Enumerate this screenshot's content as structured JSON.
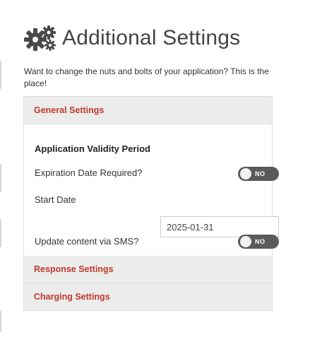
{
  "header": {
    "icon": "gears-icon",
    "title": "Additional Settings",
    "subtitle": "Want to change the nuts and bolts of your application? This is the place!"
  },
  "sections": {
    "general": {
      "label": "General Settings",
      "group_title": "Application Validity Period",
      "expiration_label": "Expiration Date Required?",
      "expiration_toggle": "NO",
      "start_date_label": "Start Date",
      "start_date_value": "2025-01-31",
      "sms_label": "Update content via SMS?",
      "sms_toggle": "NO"
    },
    "response": {
      "label": "Response Settings"
    },
    "charging": {
      "label": "Charging Settings"
    }
  },
  "colors": {
    "section_header_text": "#c0392b",
    "section_header_bg": "#ececec",
    "toggle_bg": "#5a5a5a"
  }
}
